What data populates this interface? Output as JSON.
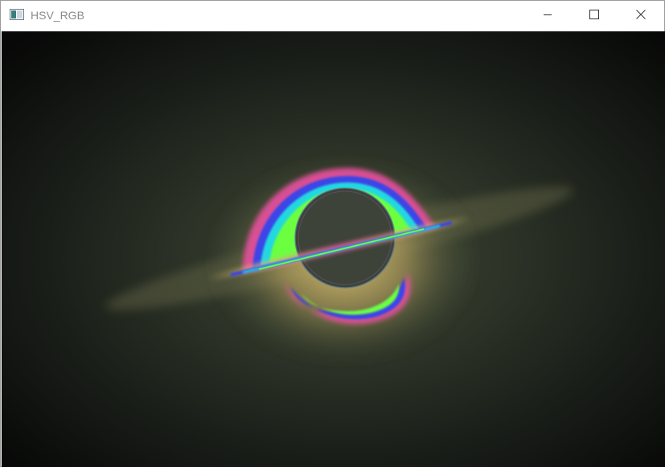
{
  "window": {
    "title": "HSV_RGB",
    "icon": "opencv-window-icon",
    "controls": [
      "minimize-icon",
      "maximize-icon",
      "close-icon"
    ]
  },
  "image": {
    "subject": "black-hole-accretion-disk-hsv-visualization",
    "colors": {
      "background_dark": "#0b0c0b",
      "haze": "#3a4232",
      "glow_yellow": "#c9b060",
      "ring_magenta": "#e0509a",
      "ring_blue": "#3a44e8",
      "ring_cyan": "#22d8e0",
      "ring_green": "#6cff40",
      "shadow_grey": "#4a5046"
    }
  }
}
